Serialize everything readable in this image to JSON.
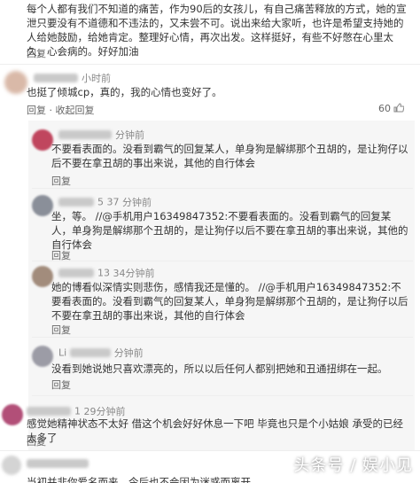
{
  "top_comment": {
    "text": "每个人都有我们不知道的痛苦，作为90后的女孩儿，有自己痛苦释放的方式，她的宣泄只要没有不道德和不违法的，又未尝不可。说出来给大家听，也许是希望支持她的人给她鼓励，给她肯定。整理好心情，再次出发。这样挺好，有些不好憋在心里太久，心会病的。好好加油",
    "reply_label": "回复"
  },
  "comments": [
    {
      "time": "小时前",
      "text": "也挺了倾城cp，真的，我的心情也变好了。",
      "actions": "回复 · 收起回复",
      "likes": "60",
      "colors": {
        "avatar": "#d9b9a8"
      }
    },
    {
      "time": "分钟前",
      "text": "不要看表面的。没看到霸气的回复某人，单身狗是解绑那个丑胡的，是让狗仔以后不要在拿丑胡的事出来说，其他的自行体会",
      "actions": "回复",
      "colors": {
        "avatar": "#c0465e"
      }
    },
    {
      "user_partial": "5 37",
      "time": "分钟前",
      "text": "坐，等。   //@手机用户16349847352:不要看表面的。没看到霸气的回复某人，单身狗是解绑那个丑胡的，是让狗仔以后不要在拿丑胡的事出来说，其他的自行体会",
      "actions": "回复",
      "colors": {
        "avatar": "#8a8f99"
      }
    },
    {
      "user_partial": "13",
      "time": "34分钟前",
      "text": "她的博看似深情实则悲伤，感情我还是懂的。  //@手机用户16349847352:不要看表面的。没看到霸气的回复某人，单身狗是解绑那个丑胡的，是让狗仔以后不要在拿丑胡的事出来说，其他的自行体会",
      "actions": "回复",
      "colors": {
        "avatar": "#a28c7c"
      }
    },
    {
      "user_partial": "Li",
      "time": "分钟前",
      "text": "没看到她说她只喜欢漂亮的，所以以后任何人都别把她和丑通扭绑在一起。",
      "actions": "回复",
      "colors": {
        "avatar": "#9c9ca6"
      }
    },
    {
      "user_partial": "1",
      "time": "29分钟前",
      "text": "感觉她精神状态不太好 借这个机会好好休息一下吧 毕竟也只是个小姑娘 承受的已经太多了",
      "actions": "回复",
      "colors": {
        "avatar": "#b24f78"
      }
    },
    {
      "text": "当初并非你爱名而来，今后也不会因为迷惑而离开"
    }
  ],
  "watermark": "头条号 / 娱小见"
}
